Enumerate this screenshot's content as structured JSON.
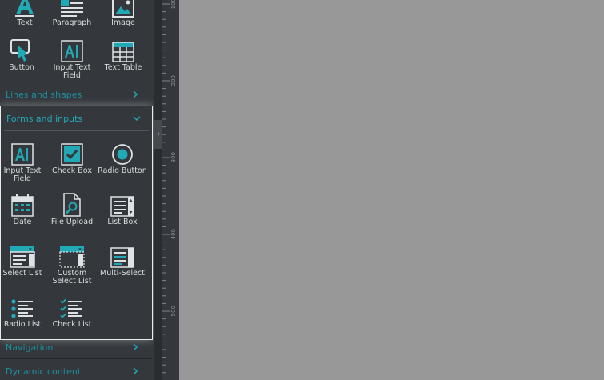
{
  "basic_tiles": [
    {
      "label": "Text",
      "icon": "text-icon"
    },
    {
      "label": "Paragraph",
      "icon": "paragraph-icon"
    },
    {
      "label": "Image",
      "icon": "image-icon"
    },
    {
      "label": "Button",
      "icon": "button-icon"
    },
    {
      "label": "Input Text Field",
      "icon": "input-text-field-icon"
    },
    {
      "label": "Text Table",
      "icon": "text-table-icon"
    }
  ],
  "sections": {
    "lines_and_shapes": "Lines and shapes",
    "forms_and_inputs": "Forms and inputs",
    "navigation": "Navigation",
    "dynamic_content": "Dynamic content"
  },
  "form_tiles": [
    {
      "label": "Input Text Field",
      "icon": "input-text-field-icon"
    },
    {
      "label": "Check Box",
      "icon": "check-box-icon"
    },
    {
      "label": "Radio Button",
      "icon": "radio-button-icon"
    },
    {
      "label": "Date",
      "icon": "calendar-icon"
    },
    {
      "label": "File Upload",
      "icon": "file-upload-icon"
    },
    {
      "label": "List Box",
      "icon": "list-box-icon"
    },
    {
      "label": "Select List",
      "icon": "select-list-icon"
    },
    {
      "label": "Custom Select List",
      "icon": "custom-select-list-icon"
    },
    {
      "label": "Multi-Select",
      "icon": "multi-select-icon"
    },
    {
      "label": "Radio List",
      "icon": "radio-list-icon"
    },
    {
      "label": "Check List",
      "icon": "check-list-icon"
    }
  ],
  "ruler": {
    "labels": [
      "100",
      "200",
      "300",
      "400",
      "500"
    ]
  },
  "colors": {
    "accent": "#22a9b6",
    "panel": "#34383c",
    "canvas": "#989898",
    "icon": "#dfe2e4"
  }
}
